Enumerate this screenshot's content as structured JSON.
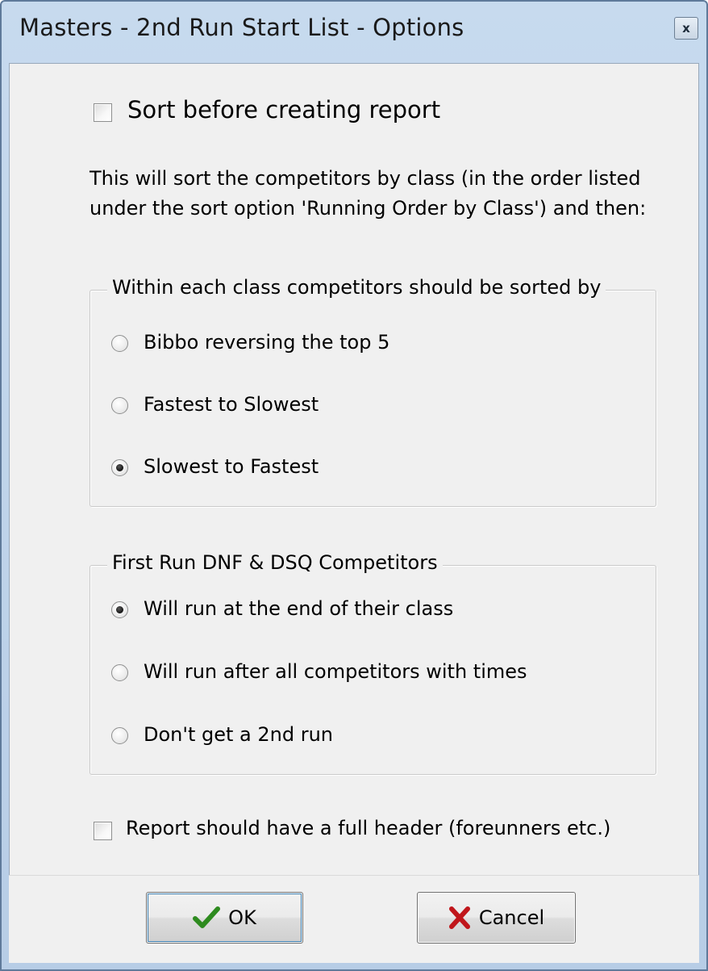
{
  "window": {
    "title": "Masters - 2nd Run Start List - Options",
    "close_label": "x"
  },
  "options": {
    "sort_before": {
      "label": "Sort before creating report",
      "checked": false
    },
    "description": "This will sort the competitors by class (in the order listed under the sort option 'Running Order by Class') and then:",
    "within_class": {
      "title": "Within each class competitors should be sorted  by",
      "items": [
        {
          "label": "Bibbo reversing the top 5",
          "selected": false
        },
        {
          "label": "Fastest to Slowest",
          "selected": false
        },
        {
          "label": "Slowest to Fastest",
          "selected": true
        }
      ]
    },
    "dnf_dsq": {
      "title": "First Run DNF & DSQ Competitors",
      "items": [
        {
          "label": "Will run at the end of their class",
          "selected": true
        },
        {
          "label": "Will run after all competitors with times",
          "selected": false
        },
        {
          "label": "Don't get a 2nd run",
          "selected": false
        }
      ]
    },
    "full_header": {
      "label": "Report should have a full header (foreunners etc.)",
      "checked": false
    }
  },
  "buttons": {
    "ok_label": "OK",
    "cancel_label": "Cancel"
  },
  "icons": {
    "ok": "checkmark-icon",
    "cancel": "x-icon",
    "ok_color": "#2e8b1f",
    "cancel_color": "#c0161b"
  }
}
